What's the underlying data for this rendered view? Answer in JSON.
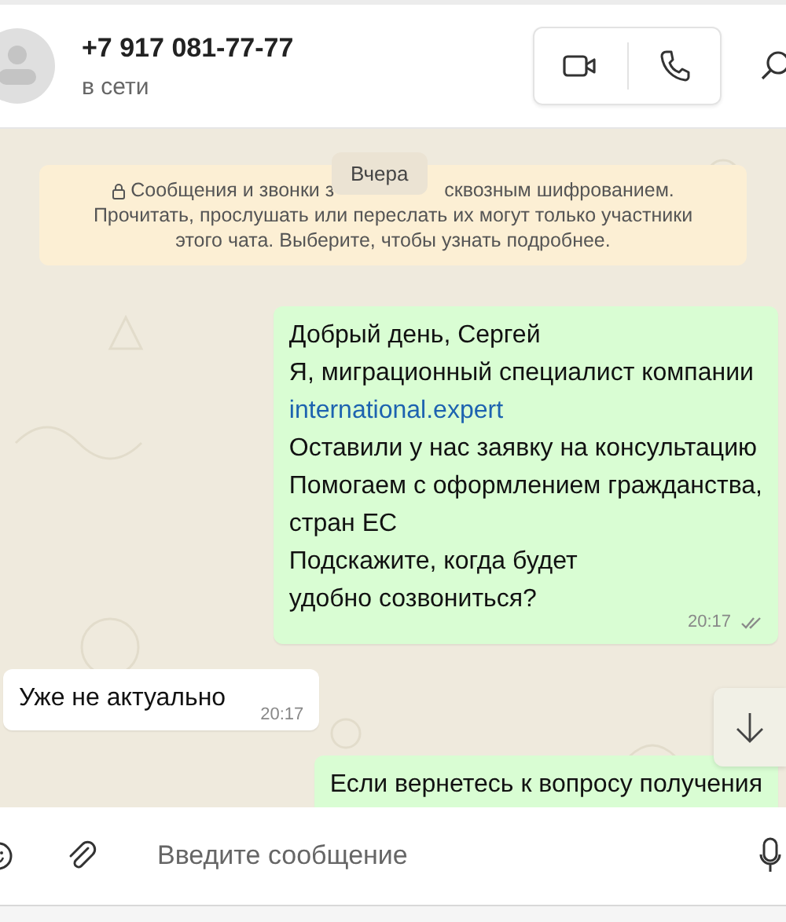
{
  "header": {
    "contact_name": "+7 917 081-77-77",
    "status": "в сети"
  },
  "notice": {
    "line_start": "Сообщения и звонки з",
    "line_end": "сквозным шифрованием.",
    "rest": [
      "Прочитать, прослушать или переслать их могут только участники",
      "этого чата. Выберите, чтобы узнать подробнее."
    ]
  },
  "date_pill": "Вчера",
  "messages": [
    {
      "kind": "outgoing",
      "lines": [
        {
          "kind": "text",
          "text": "Добрый день, Сергей"
        },
        {
          "kind": "text",
          "text": "Я, миграционный специалист компании"
        },
        {
          "kind": "link",
          "text": "international.expert"
        },
        {
          "kind": "text",
          "text": "Оставили у нас заявку на консультацию"
        },
        {
          "kind": "text",
          "text": "Помогаем с оформлением гражданства,"
        },
        {
          "kind": "text",
          "text": "стран ЕС"
        },
        {
          "kind": "text",
          "text": "Подскажите, когда будет"
        },
        {
          "kind": "text",
          "text": "удобно созвониться?"
        }
      ],
      "time": "20:17",
      "read": false
    },
    {
      "kind": "incoming",
      "lines": [
        {
          "kind": "text",
          "text": "Уже не актуально"
        }
      ],
      "time": "20:17"
    },
    {
      "kind": "outgoing",
      "lines": [
        {
          "kind": "text",
          "text": "Если вернетесь к вопросу получения"
        }
      ]
    }
  ],
  "composer": {
    "placeholder": "Введите сообщение"
  }
}
